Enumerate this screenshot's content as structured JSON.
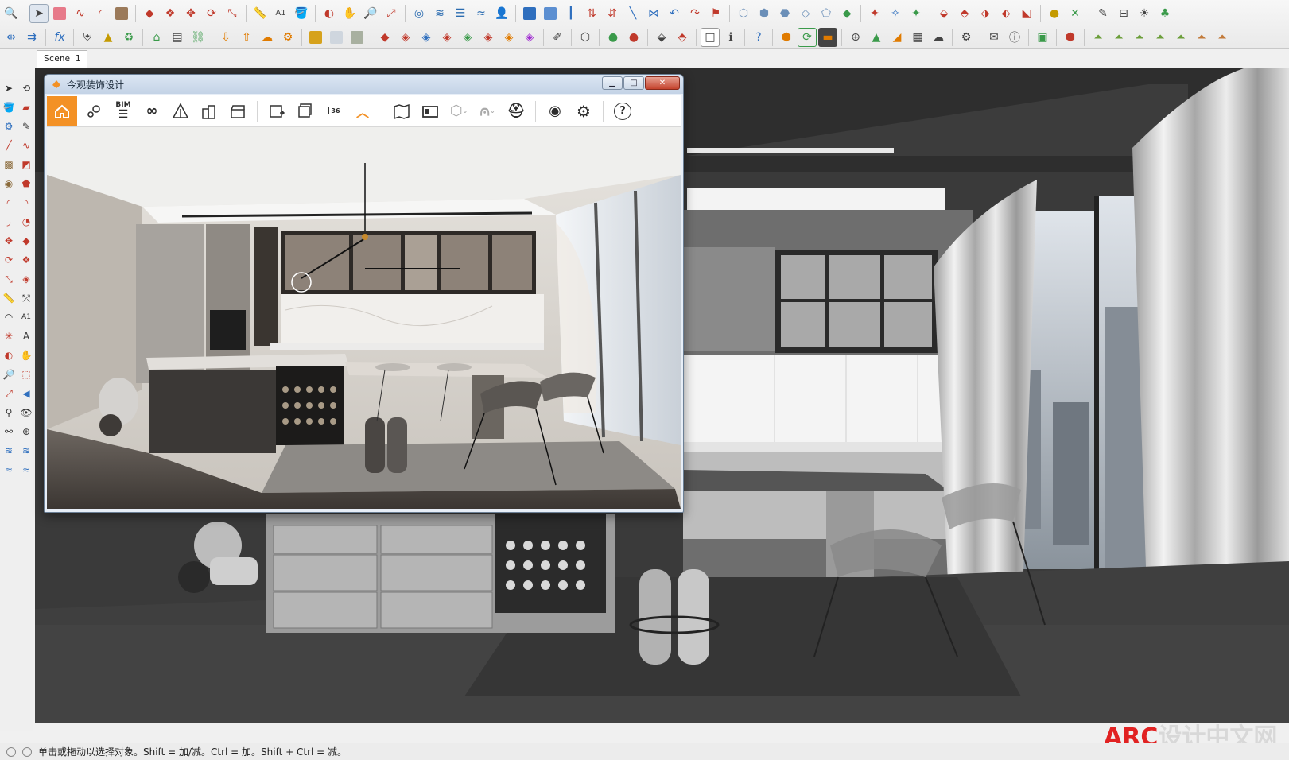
{
  "scene_tab": "Scene 1",
  "window": {
    "title": "今观装饰设计",
    "toolbar_bim": "BIM"
  },
  "status_bar": {
    "hint": "单击或拖动以选择对象。Shift = 加/减。Ctrl = 加。Shift + Ctrl = 减。"
  },
  "watermark": {
    "brand": "ARC",
    "text": "设计中文网"
  },
  "colors": {
    "accent": "#f39125",
    "viewport_bg": "#3a3a3a",
    "watermark_red": "#e12222"
  }
}
